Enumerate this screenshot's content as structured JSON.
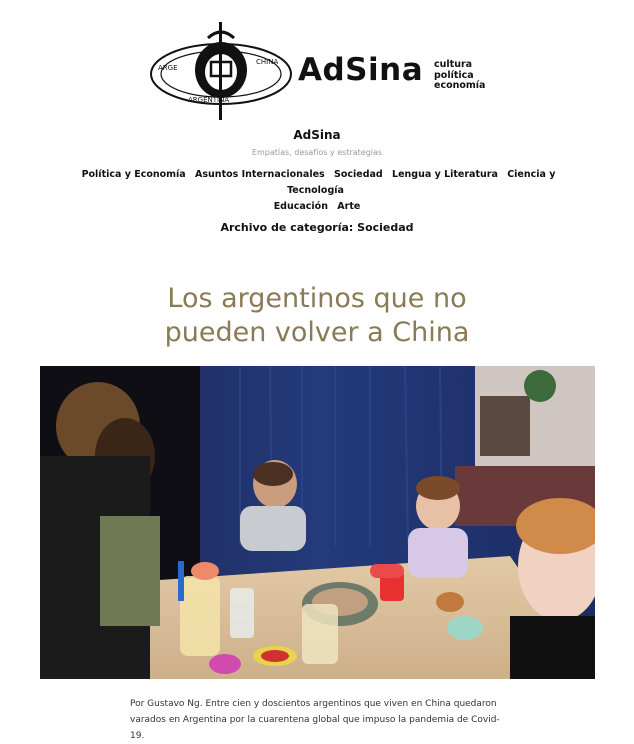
{
  "logo": {
    "wordmark": "AdSina",
    "tagline": [
      "cultura",
      "política",
      "economía"
    ],
    "ring_text": "ARGENTINA · CHINA"
  },
  "site": {
    "title": "AdSina",
    "description": "Empatías, desafíos y estrategias"
  },
  "nav": {
    "items": [
      "Política y Economía",
      "Asuntos Internacionales",
      "Sociedad",
      "Lengua y Literatura",
      "Ciencia y Tecnología",
      "Educación",
      "Arte"
    ]
  },
  "archive": {
    "title": "Archivo de categoría: Sociedad"
  },
  "post": {
    "title": "Los argentinos que no pueden volver a China",
    "excerpt": "Por Gustavo Ng. Entre cien y doscientos argentinos que viven en China quedaron varados en Argentina por la cuarentena global que impuso la pandemia de Covid-19."
  },
  "colors": {
    "post_title": "#8a7a55",
    "description": "#999999"
  }
}
